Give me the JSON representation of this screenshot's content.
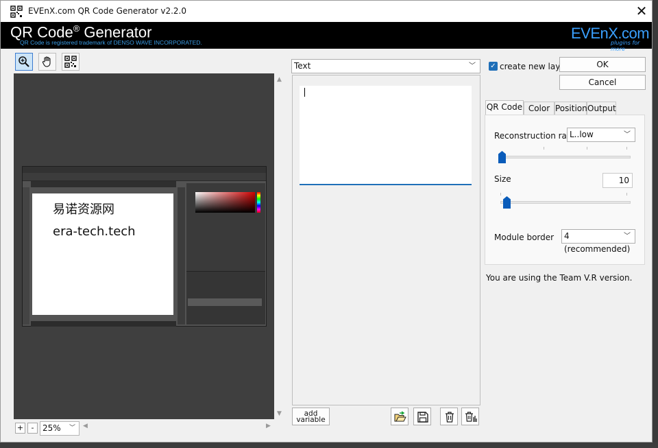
{
  "window": {
    "title": "EVEnX.com QR Code Generator v2.2.0",
    "close_symbol": "✕"
  },
  "banner": {
    "title": "QR Code",
    "title_reg": "®",
    "title_rest": " Generator",
    "subtitle": "QR Code is registered trademark of DENSO WAVE INCORPORATED.",
    "logo_text": "EVEnX.com",
    "logo_tagline": "plugins for more"
  },
  "toolbar": {
    "tools": [
      {
        "name": "zoom-tool",
        "icon": "magnifier-plus-icon",
        "active": true
      },
      {
        "name": "hand-tool",
        "icon": "hand-icon",
        "active": false
      },
      {
        "name": "qr-tool",
        "icon": "qr-code-icon",
        "active": false
      }
    ]
  },
  "preview": {
    "doc_line1": "易诺资源网",
    "doc_line2": "era-tech.tech",
    "zoom_in_label": "+",
    "zoom_out_label": "-",
    "zoom_value": "25%"
  },
  "input": {
    "type_value": "Text",
    "text_value": "",
    "add_variable_label": "add\nvariable"
  },
  "options": {
    "create_new_layer_label": "create new layer",
    "create_new_layer_checked": true,
    "ok_label": "OK",
    "cancel_label": "Cancel",
    "tabs": [
      "QR Code",
      "Color",
      "Position",
      "Output"
    ],
    "active_tab": "QR Code",
    "reconstruction_rate_label": "Reconstruction rate",
    "reconstruction_rate_value": "L..low",
    "reconstruction_rate_level": 0,
    "size_label": "Size",
    "size_value": "10",
    "module_border_label": "Module border",
    "module_border_value": "4 (recommended)",
    "version_note": "You are using the Team V.R version."
  },
  "colors": {
    "accent": "#1f6fb8",
    "banner_bg": "#000000",
    "banner_subtitle": "#3a9be3",
    "slider_thumb": "#0a5cba"
  }
}
